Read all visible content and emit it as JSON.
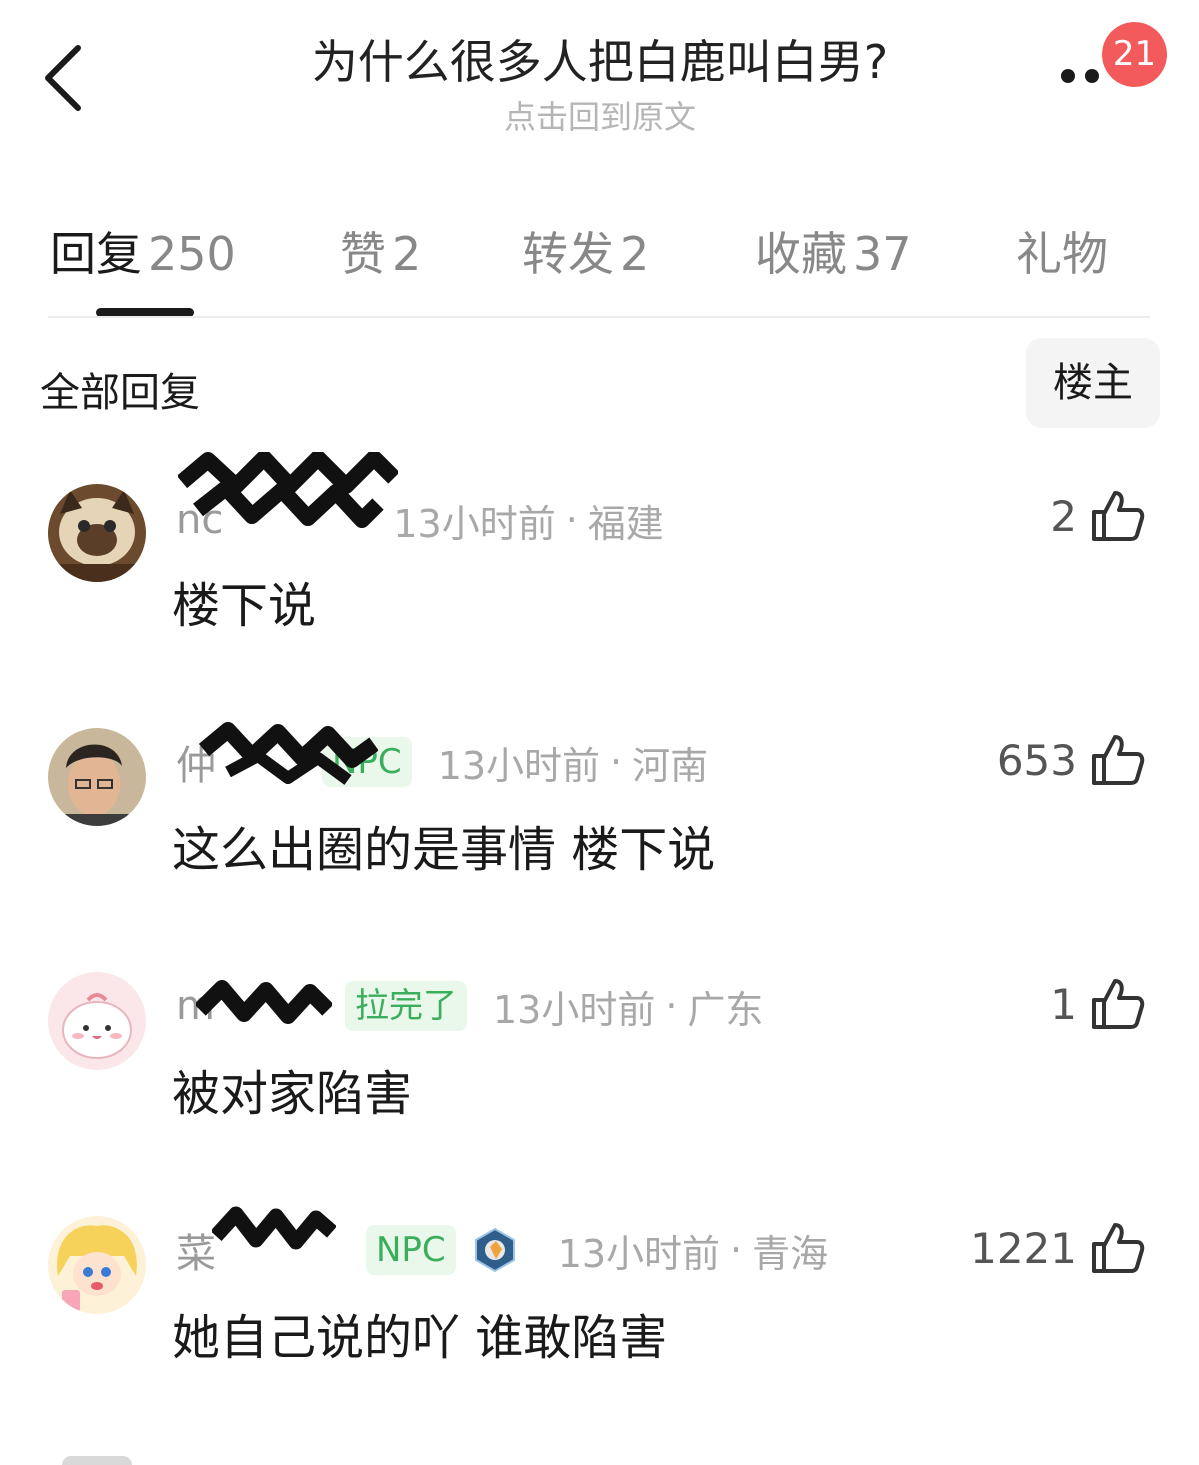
{
  "header": {
    "title": "为什么很多人把白鹿叫白男?",
    "subtitle": "点击回到原文",
    "notification_count": "21",
    "back_icon": "chevron-left-icon",
    "more_icon": "more-dots-icon"
  },
  "tabs": [
    {
      "label": "回复",
      "count": "250",
      "active": true
    },
    {
      "label": "赞",
      "count": "2"
    },
    {
      "label": "转发",
      "count": "2"
    },
    {
      "label": "收藏",
      "count": "37"
    },
    {
      "label": "礼物",
      "count": ""
    }
  ],
  "filter": {
    "all_label": "全部回复",
    "owner_label": "楼主"
  },
  "comments": [
    {
      "username": "nc",
      "tag": "",
      "time": "13小时前",
      "location": "福建",
      "text": "楼下说",
      "likes": "2"
    },
    {
      "username": "仲",
      "tag": "NPC",
      "time": "13小时前",
      "location": "河南",
      "text": "这么出圈的是事情  楼下说",
      "likes": "653"
    },
    {
      "username": "m",
      "tag": "拉完了",
      "time": "13小时前",
      "location": "广东",
      "text": "被对家陷害",
      "likes": "1"
    },
    {
      "username": "菜",
      "tag": "NPC",
      "time": "13小时前",
      "location": "青海",
      "text": "她自己说的吖 谁敢陷害",
      "likes": "1221"
    }
  ],
  "colors": {
    "accent_red": "#f25a5c",
    "tag_green": "#3aae5c",
    "muted_text": "#a8a8a8"
  }
}
